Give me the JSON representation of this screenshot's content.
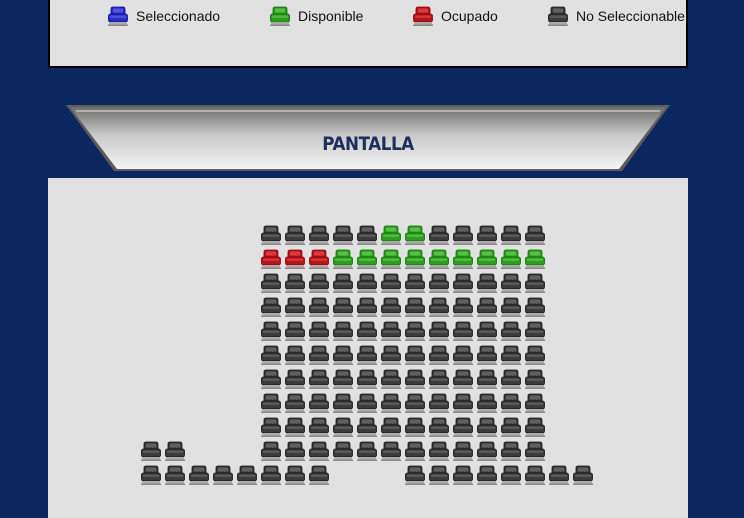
{
  "legend": {
    "items": [
      {
        "key": "selected",
        "label": "Seleccionado"
      },
      {
        "key": "available",
        "label": "Disponible"
      },
      {
        "key": "occupied",
        "label": "Ocupado"
      },
      {
        "key": "unselectable",
        "label": "No Seleccionable"
      }
    ]
  },
  "screen": {
    "label": "PANTALLA"
  },
  "colors": {
    "page_bg": "#0c2660",
    "selected": "#2a2fc0",
    "available": "#2e9a20",
    "occupied": "#b4141a",
    "unselectable": "#3b3b3b"
  },
  "seating": {
    "rows": [
      {
        "row": 1,
        "seats": [
          "x",
          "x",
          "x",
          "x",
          "x",
          "a",
          "a",
          "x",
          "x",
          "x",
          "x",
          "x"
        ],
        "start": 0
      },
      {
        "row": 2,
        "seats": [
          "o",
          "o",
          "o",
          "a",
          "a",
          "a",
          "a",
          "a",
          "a",
          "a",
          "a",
          "a"
        ],
        "start": 0
      },
      {
        "row": 3,
        "seats": [
          "x",
          "x",
          "x",
          "x",
          "x",
          "x",
          "x",
          "x",
          "x",
          "x",
          "x",
          "x"
        ],
        "start": 0
      },
      {
        "row": 4,
        "seats": [
          "x",
          "x",
          "x",
          "x",
          "x",
          "x",
          "x",
          "x",
          "x",
          "x",
          "x",
          "x"
        ],
        "start": 0
      },
      {
        "row": 5,
        "seats": [
          "x",
          "x",
          "x",
          "x",
          "x",
          "x",
          "x",
          "x",
          "x",
          "x",
          "x",
          "x"
        ],
        "start": 0
      },
      {
        "row": 6,
        "seats": [
          "x",
          "x",
          "x",
          "x",
          "x",
          "x",
          "x",
          "x",
          "x",
          "x",
          "x",
          "x"
        ],
        "start": 0
      },
      {
        "row": 7,
        "seats": [
          "x",
          "x",
          "x",
          "x",
          "x",
          "x",
          "x",
          "x",
          "x",
          "x",
          "x",
          "x"
        ],
        "start": 0
      },
      {
        "row": 8,
        "seats": [
          "x",
          "x",
          "x",
          "x",
          "x",
          "x",
          "x",
          "x",
          "x",
          "x",
          "x",
          "x"
        ],
        "start": 0
      },
      {
        "row": 9,
        "seats": [
          "x",
          "x",
          "x",
          "x",
          "x",
          "x",
          "x",
          "x",
          "x",
          "x",
          "x",
          "x"
        ],
        "start": 0
      },
      {
        "row": 10,
        "seats": [
          "x",
          "x",
          "x",
          "x",
          "x",
          "x",
          "x",
          "x",
          "x",
          "x",
          "x",
          "x"
        ],
        "start": 0
      },
      {
        "row": 10,
        "seats": [
          "x",
          "x"
        ],
        "start": -5
      },
      {
        "row": 11,
        "seats": [
          "x",
          "x",
          "x",
          "x",
          "x",
          "x",
          "x",
          "x"
        ],
        "start": -5
      },
      {
        "row": 11,
        "seats": [
          "x",
          "x",
          "x",
          "x",
          "x",
          "x",
          "x",
          "x"
        ],
        "start": 6
      }
    ]
  }
}
